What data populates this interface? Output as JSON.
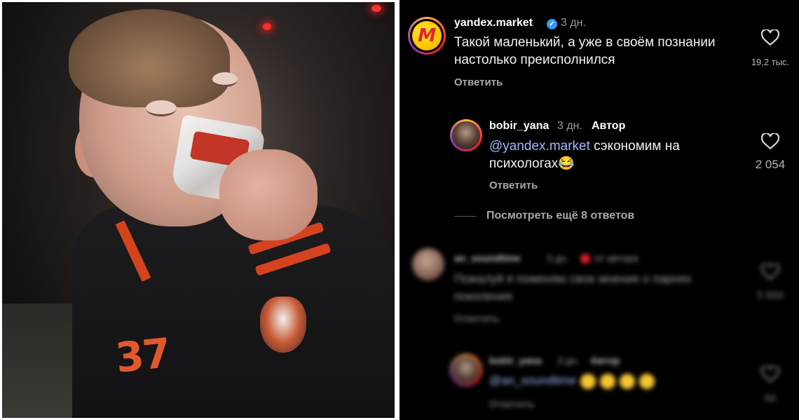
{
  "comments": [
    {
      "username": "yandex.market",
      "avatar_letter": "M",
      "time": "3 дн.",
      "text": "Такой маленький, а уже в своём познании настолько преисполнился",
      "reply_label": "Ответить",
      "likes": "19,2 тыс."
    },
    {
      "username": "bobir_yana",
      "time": "3 дн.",
      "author_tag": "Автор",
      "mention": "@yandex.market",
      "text": " сэкономим на психологах😂",
      "reply_label": "Ответить",
      "likes": "2 054"
    }
  ],
  "view_more": "Посмотреть ещё 8 ответов",
  "blurred": [
    {
      "username": "an_soundtime",
      "time": "3 дн.",
      "liked_by": "от автора",
      "text": "Пожалуй я поменяю свое мнение о парнях поколения",
      "reply_label": "Ответить",
      "likes": "5 669"
    },
    {
      "username": "bobir_yana",
      "time": "3 дн.",
      "author_tag": "Автор",
      "mention": "@an_soundtime",
      "reply_label": "Ответить",
      "likes": "99"
    }
  ],
  "photo": {
    "jacket_number": "37"
  },
  "colors": {
    "panel_bg": "#000000",
    "mention": "#9fb8ff",
    "verified": "#3897f0",
    "jacket_stripe": "#d5431e"
  }
}
